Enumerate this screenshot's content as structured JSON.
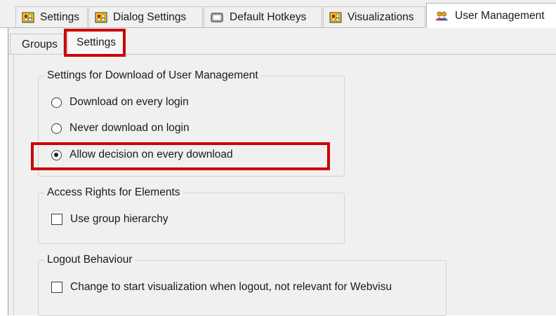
{
  "tabs": [
    {
      "label": "Settings",
      "icon": "settings-grid-icon"
    },
    {
      "label": "Dialog Settings",
      "icon": "dialog-grid-icon"
    },
    {
      "label": "Default Hotkeys",
      "icon": "keyboard-icon"
    },
    {
      "label": "Visualizations",
      "icon": "visualization-grid-icon"
    },
    {
      "label": "User Management",
      "icon": "users-icon",
      "active": true
    }
  ],
  "subtabs": [
    {
      "label": "Groups"
    },
    {
      "label": "Settings",
      "active": true
    }
  ],
  "download_group": {
    "legend": "Settings for Download of User Management",
    "options": [
      {
        "label": "Download on every login",
        "selected": false
      },
      {
        "label": "Never download on login",
        "selected": false
      },
      {
        "label": "Allow decision on every download",
        "selected": true
      }
    ]
  },
  "access_group": {
    "legend": "Access Rights for Elements",
    "checkbox": {
      "label": "Use group hierarchy",
      "checked": false
    }
  },
  "logout_group": {
    "legend": "Logout Behaviour",
    "checkbox": {
      "label": "Change to start visualization when logout, not relevant for Webvisu",
      "checked": false
    }
  },
  "colors": {
    "highlight": "#cc0000",
    "panel": "#f0f0f0"
  }
}
